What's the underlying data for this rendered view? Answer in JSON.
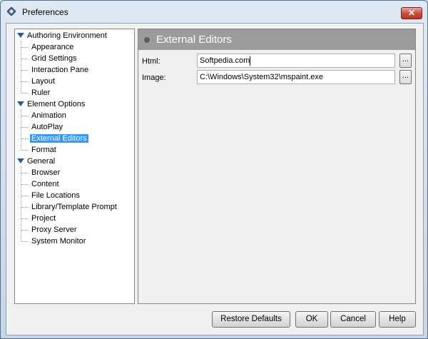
{
  "window": {
    "title": "Preferences",
    "close_glyph": "✕"
  },
  "tree": {
    "groups": [
      {
        "label": "Authoring Environment",
        "children": [
          "Appearance",
          "Grid Settings",
          "Interaction Pane",
          "Layout",
          "Ruler"
        ]
      },
      {
        "label": "Element Options",
        "children": [
          "Animation",
          "AutoPlay",
          "External Editors",
          "Format"
        ]
      },
      {
        "label": "General",
        "children": [
          "Browser",
          "Content",
          "File Locations",
          "Library/Template Prompt",
          "Project",
          "Proxy Server",
          "System Monitor"
        ]
      }
    ],
    "selected": "External Editors"
  },
  "panel": {
    "title": "External Editors",
    "fields": [
      {
        "label": "Html:",
        "value": "Softpedia.com",
        "browse": "..."
      },
      {
        "label": "Image:",
        "value": "C:\\Windows\\System32\\mspaint.exe",
        "browse": "..."
      }
    ]
  },
  "buttons": {
    "restore_defaults": "Restore Defaults",
    "ok": "OK",
    "cancel": "Cancel",
    "help": "Help"
  },
  "colors": {
    "selection": "#3399ff",
    "panel_header": "#9b9b9b",
    "tree_triangle": "#2a5d9a",
    "close_button": "#c84a36"
  },
  "icons": {
    "app": "diamond-icon",
    "expand": "triangle-down-icon"
  }
}
